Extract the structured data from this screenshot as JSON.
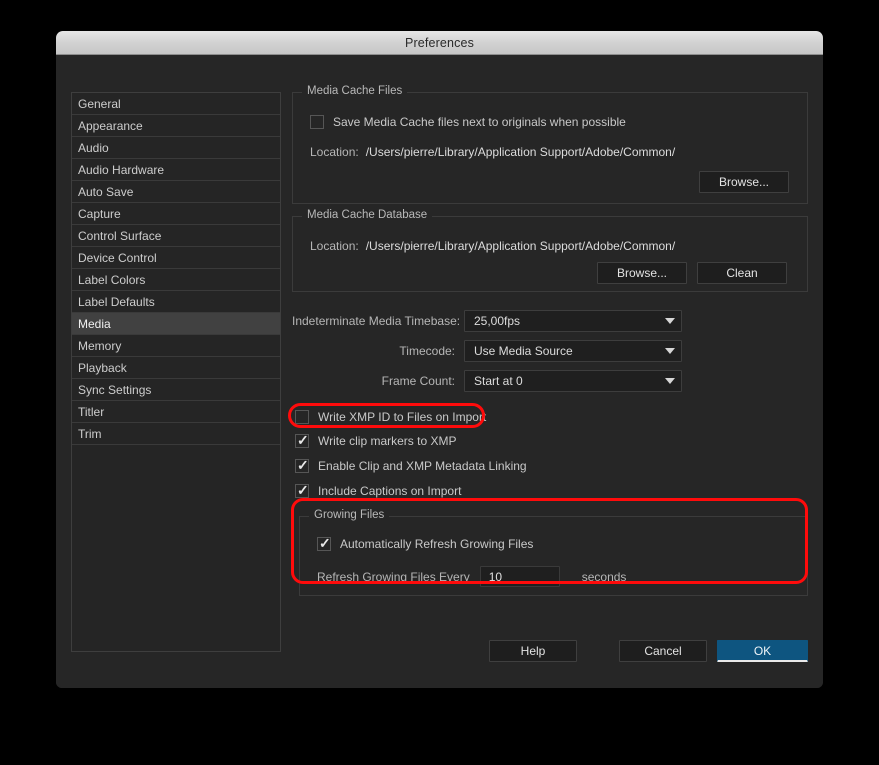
{
  "window": {
    "title": "Preferences"
  },
  "sidebar": {
    "items": [
      {
        "label": "General",
        "selected": false
      },
      {
        "label": "Appearance",
        "selected": false
      },
      {
        "label": "Audio",
        "selected": false
      },
      {
        "label": "Audio Hardware",
        "selected": false
      },
      {
        "label": "Auto Save",
        "selected": false
      },
      {
        "label": "Capture",
        "selected": false
      },
      {
        "label": "Control Surface",
        "selected": false
      },
      {
        "label": "Device Control",
        "selected": false
      },
      {
        "label": "Label Colors",
        "selected": false
      },
      {
        "label": "Label Defaults",
        "selected": false
      },
      {
        "label": "Media",
        "selected": true
      },
      {
        "label": "Memory",
        "selected": false
      },
      {
        "label": "Playback",
        "selected": false
      },
      {
        "label": "Sync Settings",
        "selected": false
      },
      {
        "label": "Titler",
        "selected": false
      },
      {
        "label": "Trim",
        "selected": false
      }
    ]
  },
  "media_cache_files": {
    "legend": "Media Cache Files",
    "save_next_to_originals": {
      "label": "Save Media Cache files next to originals when possible",
      "checked": false
    },
    "location_label": "Location:",
    "location_value": "/Users/pierre/Library/Application Support/Adobe/Common/",
    "browse_label": "Browse..."
  },
  "media_cache_database": {
    "legend": "Media Cache Database",
    "location_label": "Location:",
    "location_value": "/Users/pierre/Library/Application Support/Adobe/Common/",
    "browse_label": "Browse...",
    "clean_label": "Clean"
  },
  "dropdowns": [
    {
      "label": "Indeterminate Media Timebase:",
      "value": "25,00fps"
    },
    {
      "label": "Timecode:",
      "value": "Use Media Source"
    },
    {
      "label": "Frame Count:",
      "value": "Start at 0"
    }
  ],
  "checkboxes": [
    {
      "label": "Write XMP ID to Files on Import",
      "checked": false,
      "highlighted": true
    },
    {
      "label": "Write clip markers to XMP",
      "checked": true,
      "highlighted": false
    },
    {
      "label": "Enable Clip and XMP Metadata Linking",
      "checked": true,
      "highlighted": false
    },
    {
      "label": "Include Captions on Import",
      "checked": true,
      "highlighted": false
    }
  ],
  "growing_files": {
    "legend": "Growing Files",
    "auto_refresh": {
      "label": "Automatically Refresh Growing Files",
      "checked": true
    },
    "refresh_every_label": "Refresh Growing Files Every",
    "refresh_value": "10",
    "seconds_label": "seconds"
  },
  "footer": {
    "help_label": "Help",
    "cancel_label": "Cancel",
    "ok_label": "OK"
  },
  "colors": {
    "annotation": "#ff0b0b",
    "accent": "#0e5580",
    "dialog_bg": "#262626",
    "selected_row": "#414141"
  }
}
